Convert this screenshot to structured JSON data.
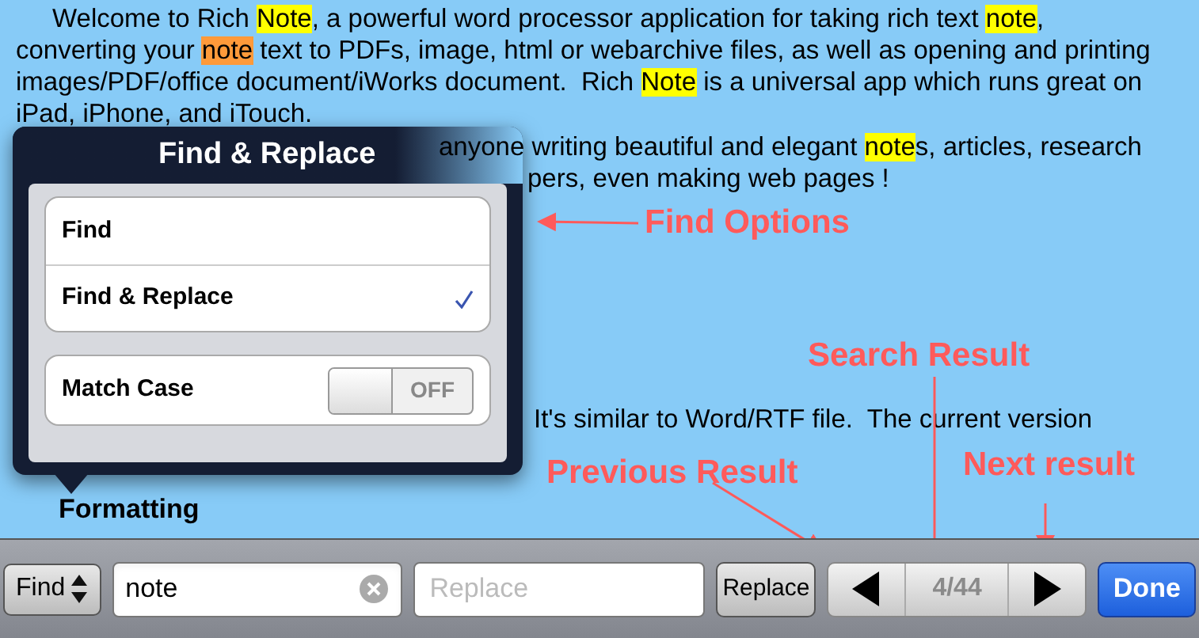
{
  "document": {
    "paragraphs": [
      {
        "lines": [
          [
            {
              "text": "Welcome to Rich "
            },
            {
              "text": "Note",
              "highlighted": true,
              "current": false
            },
            {
              "text": ", a powerful word processor application for taking rich text "
            },
            {
              "text": "note",
              "highlighted": true,
              "current": false
            },
            {
              "text": ","
            }
          ],
          [
            {
              "text": "converting your "
            },
            {
              "text": "note",
              "highlighted": true,
              "current": true
            },
            {
              "text": " text to PDFs, image, html or webarchive files, as well as opening and printing"
            }
          ],
          [
            {
              "text": "images/PDF/office document/iWorks document.  Rich "
            },
            {
              "text": "Note",
              "highlighted": true,
              "current": false
            },
            {
              "text": " is a universal app which runs great on"
            }
          ],
          [
            {
              "text": "iPad, iPhone, and iTouch."
            }
          ]
        ]
      },
      {
        "lines": [
          [
            {
              "text": "anyone writing beautiful and elegant "
            },
            {
              "text": "note",
              "highlighted": true,
              "current": false
            },
            {
              "text": "s, articles, research"
            }
          ],
          [
            {
              "text": "pers, even making web pages !"
            }
          ]
        ]
      },
      {
        "lines": [
          [
            {
              "text": "It's similar to Word/RTF file.  The current version"
            }
          ]
        ]
      },
      {
        "heading": "Formatting"
      }
    ]
  },
  "popover": {
    "title": "Find & Replace",
    "modes": [
      {
        "label": "Find",
        "selected": false
      },
      {
        "label": "Find & Replace",
        "selected": true
      }
    ],
    "match_case": {
      "label": "Match Case",
      "on": false,
      "state_text": "OFF"
    }
  },
  "annotations": [
    "Find Options",
    "Search Result",
    "Previous Result",
    "Next result"
  ],
  "toolbar": {
    "mode_button": "Find",
    "search_value": "note",
    "replace_placeholder": "Replace",
    "replace_button": "Replace",
    "result": "4/44",
    "done": "Done"
  }
}
